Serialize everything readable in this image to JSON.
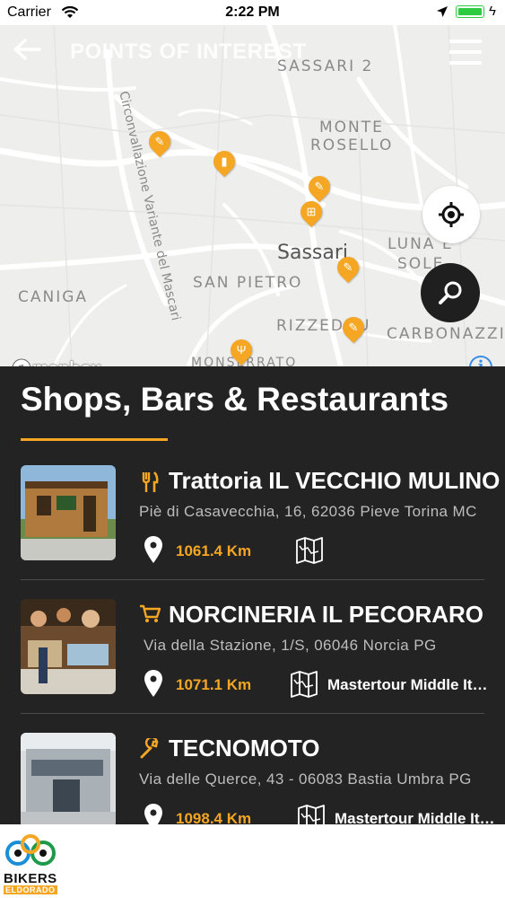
{
  "status_bar": {
    "carrier": "Carrier",
    "time": "2:22 PM"
  },
  "header": {
    "title": "POINTS OF INTEREST",
    "back_icon": "arrow-left-icon",
    "menu_icon": "hamburger-menu-icon"
  },
  "map": {
    "labels": {
      "sassari2": "SASSARI 2",
      "monte_rosello": "MONTE",
      "monte_rosello_2": "ROSELLO",
      "sassari": "Sassari",
      "luna_e_sole": "LUNA E",
      "luna_e_sole_2": "SOLE",
      "caniga": "CANIGA",
      "san_pietro": "SAN PIETRO",
      "rizzeddu": "RIZZEDDU",
      "carbonazzi": "CARBONAZZI",
      "monserrato": "MONSERRATO",
      "road": "Circonvallazione Variante del Mascari"
    },
    "attribution": "mapbox",
    "info_icon": "info-icon",
    "locate_icon": "crosshair-icon",
    "search_icon": "search-icon"
  },
  "section": {
    "title": "Shops, Bars & Restaurants"
  },
  "items": [
    {
      "category_icon": "fork-knife-icon",
      "name": "Trattoria IL VECCHIO MULINO",
      "address": "Piè di Casavecchia, 16, 62036 Pieve Torina MC",
      "distance": "1061.4 Km",
      "tour": ""
    },
    {
      "category_icon": "cart-icon",
      "name": "NORCINERIA IL PECORARO",
      "address": "Via della Stazione, 1/S, 06046 Norcia PG",
      "distance": "1071.1 Km",
      "tour": "Mastertour Middle Italy"
    },
    {
      "category_icon": "wrench-icon",
      "name": "TECNOMOTO",
      "address": "Via delle Querce, 43 - 06083 Bastia Umbra PG",
      "distance": "1098.4 Km",
      "tour": "Mastertour Middle Italy"
    }
  ],
  "footer": {
    "logo_name": "BIKERS",
    "logo_sub": "ELDORADO"
  },
  "colors": {
    "accent": "#f5a623",
    "panel": "#232323",
    "map_bg": "#eeeeec"
  }
}
